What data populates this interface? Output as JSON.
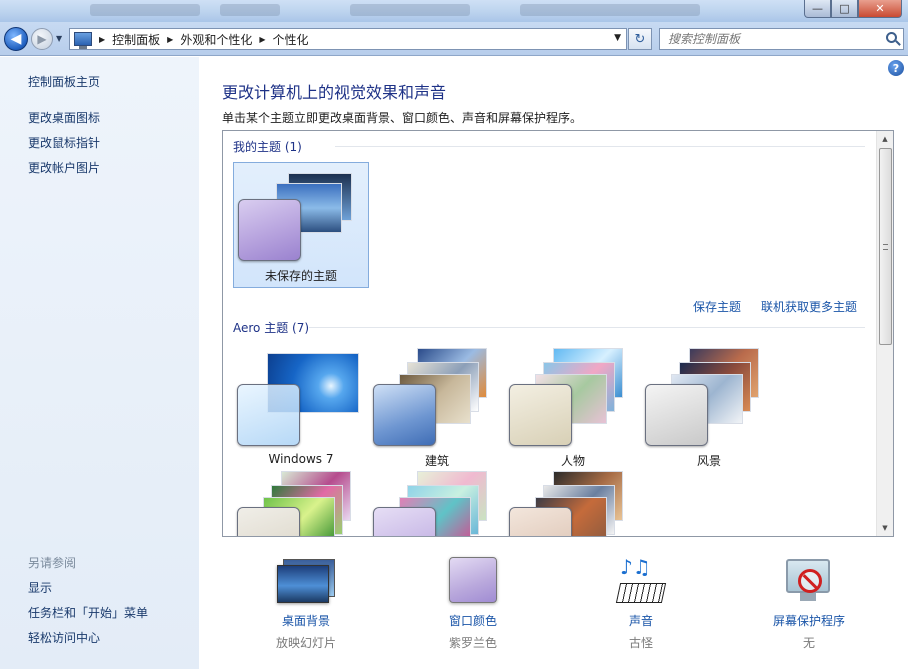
{
  "window": {
    "close_glyph": "✕",
    "maximize_glyph": "□",
    "minimize_glyph": "—"
  },
  "nav": {
    "back_glyph": "◀",
    "forward_glyph": "▶",
    "breadcrumbs": [
      "控制面板",
      "外观和个性化",
      "个性化"
    ],
    "search_placeholder": "搜索控制面板"
  },
  "sidebar": {
    "home": "控制面板主页",
    "links": [
      "更改桌面图标",
      "更改鼠标指针",
      "更改帐户图片"
    ],
    "see_also_title": "另请参阅",
    "see_also": [
      "显示",
      "任务栏和「开始」菜单",
      "轻松访问中心"
    ]
  },
  "main": {
    "title": "更改计算机上的视觉效果和声音",
    "description": "单击某个主题立即更改桌面背景、窗口颜色、声音和屏幕保护程序。",
    "my_themes_header": "我的主题 (1)",
    "my_themes": [
      {
        "label": "未保存的主题",
        "selected": true
      }
    ],
    "save_theme_link": "保存主题",
    "get_more_link": "联机获取更多主题",
    "aero_header": "Aero 主题 (7)",
    "aero_themes": [
      {
        "label": "Windows 7",
        "icon": "windows7-theme"
      },
      {
        "label": "建筑",
        "icon": "architecture-theme"
      },
      {
        "label": "人物",
        "icon": "characters-theme"
      },
      {
        "label": "风景",
        "icon": "landscapes-theme"
      },
      {
        "label": "",
        "icon": "nature-theme"
      },
      {
        "label": "",
        "icon": "scenes-theme"
      },
      {
        "label": "",
        "icon": "united-states-theme"
      }
    ]
  },
  "quick_settings": [
    {
      "title": "桌面背景",
      "value": "放映幻灯片",
      "icon": "desktop-background-icon"
    },
    {
      "title": "窗口颜色",
      "value": "紫罗兰色",
      "icon": "window-color-icon"
    },
    {
      "title": "声音",
      "value": "古怪",
      "icon": "sounds-icon"
    },
    {
      "title": "屏幕保护程序",
      "value": "无",
      "icon": "screensaver-icon"
    }
  ],
  "colors": {
    "link": "#1a55a8",
    "title": "#1e3287",
    "window_color": "#b9a8dc",
    "selection": "#d2e5fb"
  }
}
